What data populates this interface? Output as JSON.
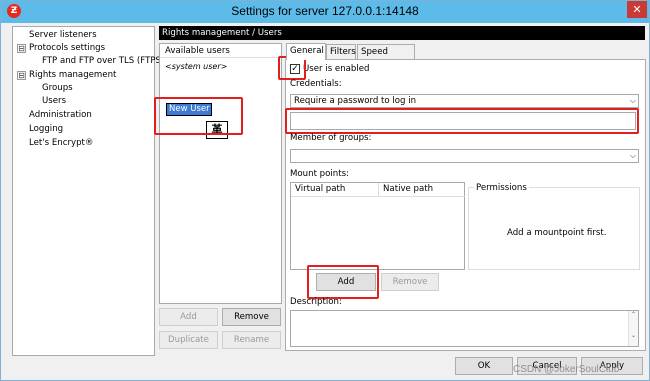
{
  "window": {
    "title": "Settings for server 127.0.0.1:14148",
    "app_icon": "filezilla-icon",
    "close_label": "✕"
  },
  "tree": {
    "items": [
      {
        "label": "Server listeners"
      },
      {
        "label": "Protocols settings",
        "expander": "⊟"
      },
      {
        "label": "FTP and FTP over TLS (FTPS)"
      },
      {
        "label": "Rights management",
        "expander": "⊟"
      },
      {
        "label": "Groups"
      },
      {
        "label": "Users"
      },
      {
        "label": "Administration"
      },
      {
        "label": "Logging"
      },
      {
        "label": "Let's Encrypt®"
      }
    ]
  },
  "section_header": "Rights management / Users",
  "users": {
    "header": "Available users",
    "system_user": "<system user>",
    "new_user_value": "New User",
    "ime_char": "革",
    "buttons": {
      "add": "Add",
      "remove": "Remove",
      "duplicate": "Duplicate",
      "rename": "Rename"
    }
  },
  "tabs": [
    {
      "label": "General"
    },
    {
      "label": "Filters"
    },
    {
      "label": "Speed Limits"
    }
  ],
  "general": {
    "user_enabled_label": "User is enabled",
    "user_enabled_checked": "✓",
    "credentials_label": "Credentials:",
    "credentials_value": "Require a password to log in",
    "password_value": "",
    "member_of_groups_label": "Member of groups:",
    "member_of_groups_value": "",
    "mount_points_label": "Mount points:",
    "mount_columns": [
      "Virtual path",
      "Native path"
    ],
    "permissions_label": "Permissions",
    "permissions_placeholder": "Add a mountpoint first.",
    "add_label": "Add",
    "remove_label": "Remove",
    "description_label": "Description:"
  },
  "footer": {
    "ok": "OK",
    "cancel": "Cancel",
    "apply": "Apply"
  },
  "watermark": "CSDN @JokerSoulClub",
  "colors": {
    "titlebar": "#5dbbea",
    "highlight_frame": "#e02020",
    "selection": "#3b7bd4"
  }
}
